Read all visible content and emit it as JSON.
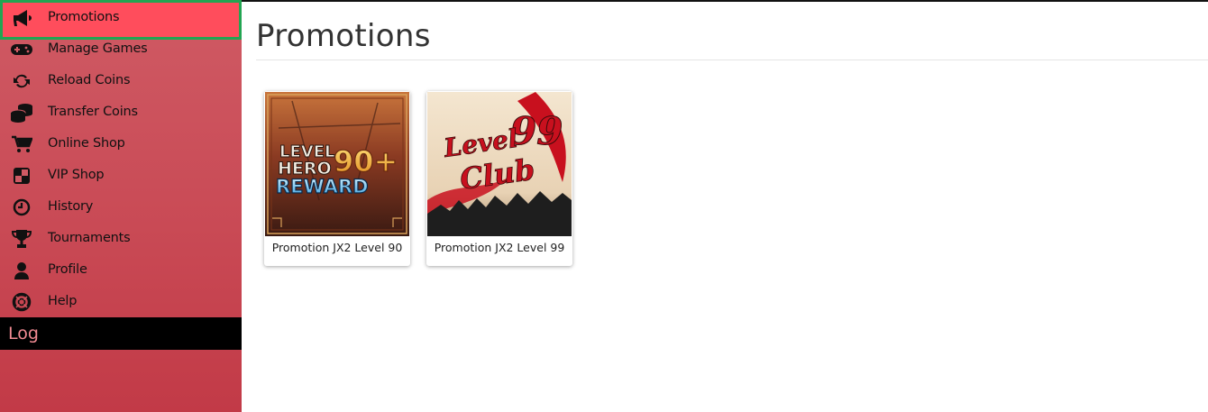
{
  "sidebar": {
    "items": [
      {
        "label": "Promotions",
        "icon": "megaphone-icon",
        "active": true
      },
      {
        "label": "Manage Games",
        "icon": "gamepad-icon"
      },
      {
        "label": "Reload Coins",
        "icon": "refresh-icon"
      },
      {
        "label": "Transfer Coins",
        "icon": "coins-icon"
      },
      {
        "label": "Online Shop",
        "icon": "shopping-cart-icon"
      },
      {
        "label": "VIP Shop",
        "icon": "checkered-square-icon"
      },
      {
        "label": "History",
        "icon": "clock-icon"
      },
      {
        "label": "Tournaments",
        "icon": "trophy-icon"
      },
      {
        "label": "Profile",
        "icon": "user-icon"
      },
      {
        "label": "Help",
        "icon": "life-ring-icon"
      }
    ],
    "log_label": "Log",
    "active_color": "#ff4d5c",
    "focus_outline_color": "#22a552"
  },
  "main": {
    "title": "Promotions",
    "cards": [
      {
        "caption": "Promotion JX2 Level 90",
        "image_text": {
          "line1": "LEVEL",
          "line2": "HERO",
          "number": "90+",
          "line3": "REWARD"
        }
      },
      {
        "caption": "Promotion JX2 Level 99",
        "image_text": {
          "line1": "Level",
          "number": "99",
          "line2": "Club"
        }
      }
    ]
  }
}
